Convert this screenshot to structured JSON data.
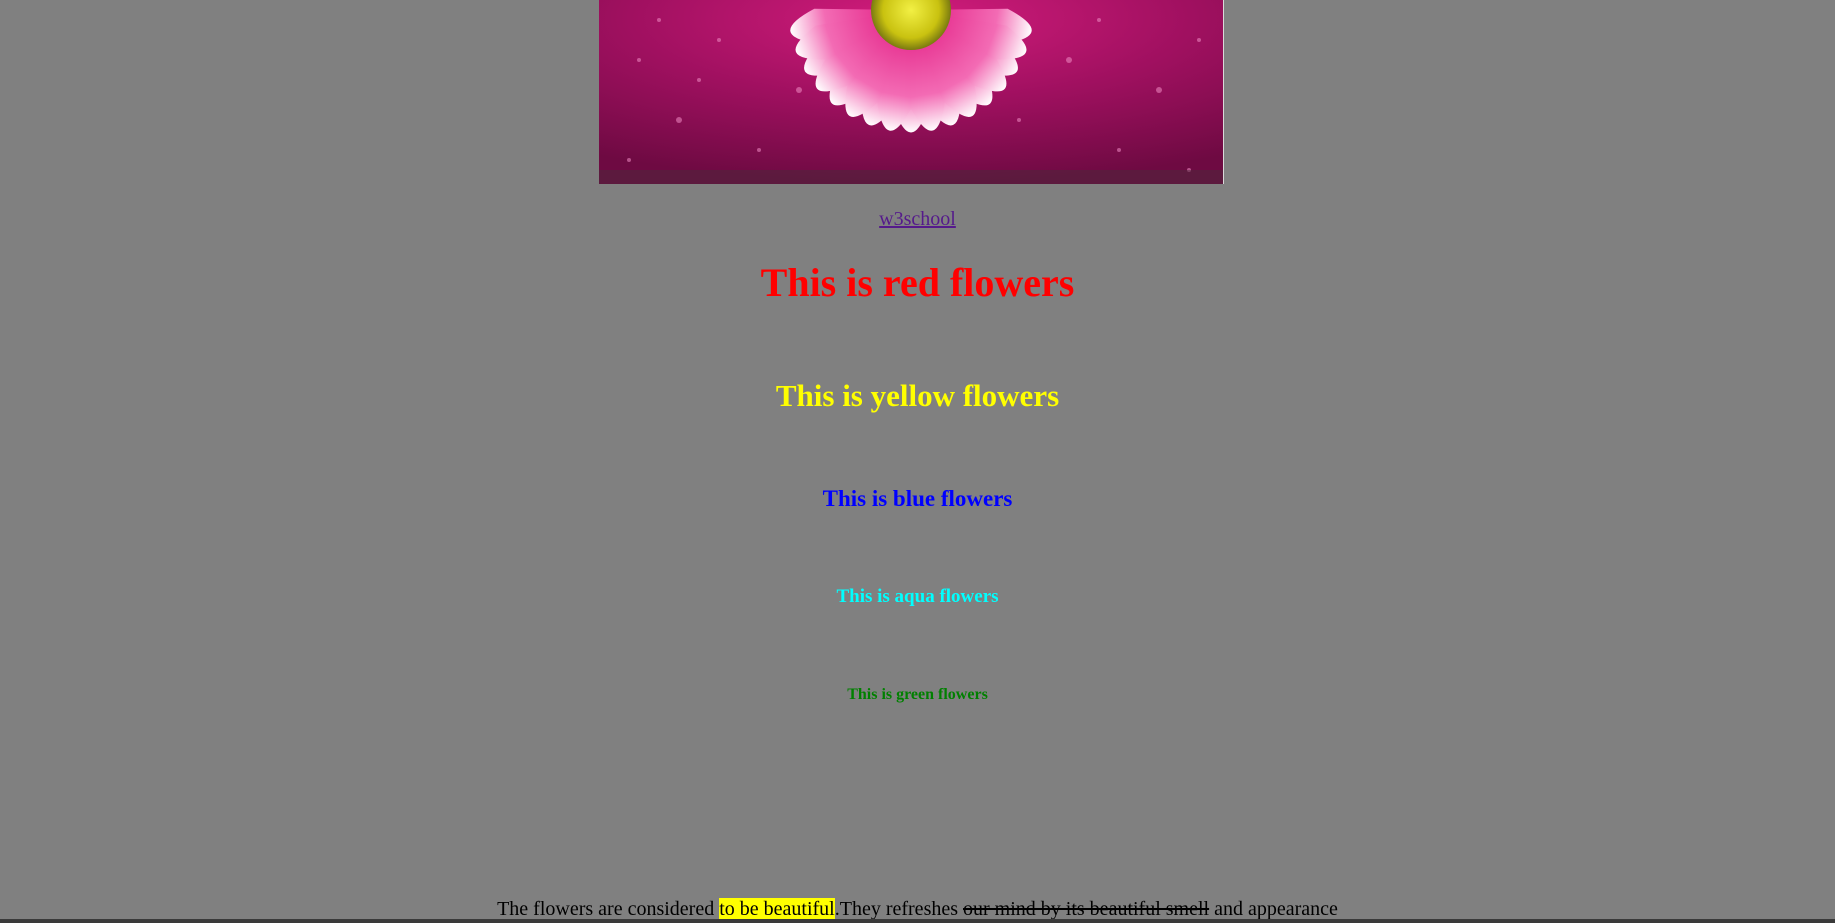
{
  "image": {
    "alt": "pink daisy flower with water drops"
  },
  "link": {
    "label": "w3school"
  },
  "headings": {
    "red": "This is red flowers",
    "yellow": "This is yellow flowers",
    "blue": "This is blue flowers",
    "aqua": "This is aqua flowers",
    "green": "This is green flowers"
  },
  "paragraph": {
    "part1": "The flowers are considered ",
    "highlight": "to be beautiful",
    "part2": ".They refreshes ",
    "strike": "our mind by its beautiful smell",
    "part3": " and appearance"
  },
  "colors": {
    "background": "#808080",
    "red": "#ff0000",
    "yellow": "#ffff00",
    "blue": "#0000ff",
    "aqua": "#00ffff",
    "green": "#008000",
    "link": "#551a8b",
    "highlight": "#ffff00"
  }
}
